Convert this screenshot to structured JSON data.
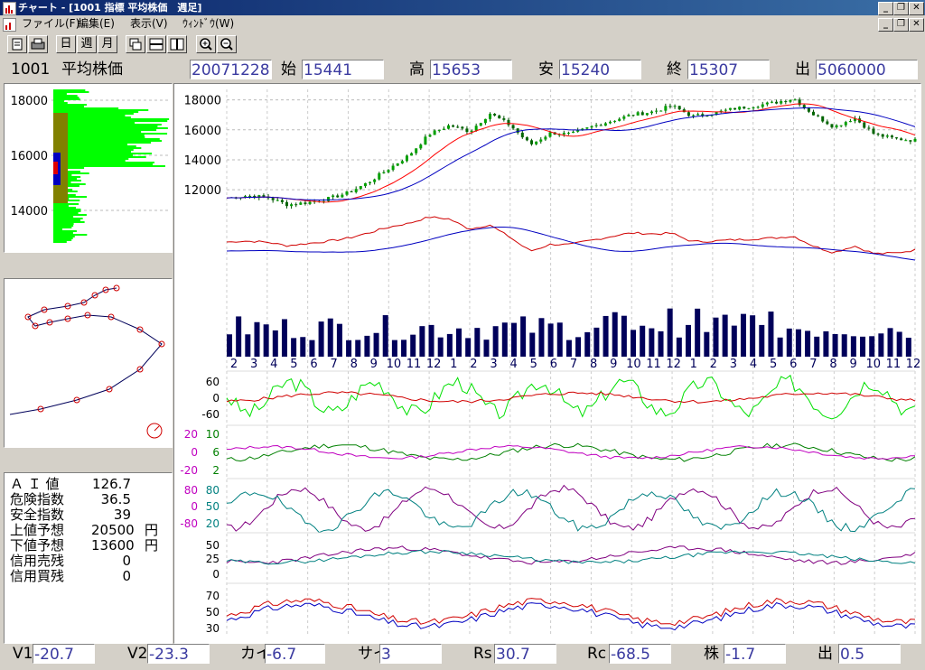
{
  "window": {
    "title": "チャート - [1001 指標 平均株価　週足]",
    "buttons": [
      "_",
      "❐",
      "✕"
    ]
  },
  "menu": {
    "items": [
      "ファイル(F)",
      "編集(E)",
      "表示(V)",
      "ｳｨﾝﾄﾞｳ(W)"
    ],
    "doc_buttons": [
      "_",
      "❐",
      "✕"
    ]
  },
  "toolbar": {
    "day": "日",
    "week": "週",
    "month": "月"
  },
  "info": {
    "code": "1001",
    "name": "平均株価",
    "date": "20071228",
    "open_label": "始",
    "open": "15441",
    "high_label": "高",
    "high": "15653",
    "low_label": "安",
    "low": "15240",
    "close_label": "終",
    "close": "15307",
    "volume_label": "出",
    "volume": "5060000"
  },
  "left_panels": {
    "profile_ticks": [
      "18000",
      "16000",
      "14000"
    ],
    "ai": {
      "rows": [
        {
          "label": "Ａ Ｉ 値",
          "value": "126.7",
          "unit": ""
        },
        {
          "label": "危険指数",
          "value": "36.5",
          "unit": ""
        },
        {
          "label": "安全指数",
          "value": "39",
          "unit": ""
        },
        {
          "label": "上値予想",
          "value": "20500",
          "unit": "円"
        },
        {
          "label": "下値予想",
          "value": "13600",
          "unit": "円"
        },
        {
          "label": "信用売残",
          "value": "0",
          "unit": ""
        },
        {
          "label": "信用買残",
          "value": "0",
          "unit": ""
        }
      ]
    }
  },
  "chart": {
    "price_ticks": [
      "18000",
      "16000",
      "14000",
      "12000"
    ],
    "months": [
      "2",
      "3",
      "4",
      "5",
      "6",
      "7",
      "8",
      "9",
      "10",
      "11",
      "12",
      "1",
      "2",
      "3",
      "4",
      "5",
      "6",
      "7",
      "8",
      "9",
      "10",
      "11",
      "12",
      "1",
      "2",
      "3",
      "4",
      "5",
      "6",
      "7",
      "8",
      "9",
      "10",
      "11",
      "12"
    ],
    "ind1_ticks": [
      "60",
      "0",
      "-60"
    ],
    "ind2_left_ticks": [
      "20",
      "0",
      "-20"
    ],
    "ind2_ticks": [
      "10",
      "6",
      "2"
    ],
    "ind3_left_ticks": [
      "80",
      "0",
      "-80"
    ],
    "ind3_ticks": [
      "80",
      "50",
      "20"
    ],
    "ind4_ticks": [
      "50",
      "25",
      "0"
    ],
    "ind5_ticks": [
      "70",
      "50",
      "30"
    ]
  },
  "chart_data": {
    "type": "line",
    "title": "1001 指標 平均株価 週足",
    "ylim": [
      10500,
      18700
    ],
    "yticks": [
      18000,
      16000,
      14000,
      12000
    ],
    "x": [
      "2",
      "3",
      "4",
      "5",
      "6",
      "7",
      "8",
      "9",
      "10",
      "11",
      "12",
      "1",
      "2",
      "3",
      "4",
      "5",
      "6",
      "7",
      "8",
      "9",
      "10",
      "11",
      "12",
      "1",
      "2",
      "3",
      "4",
      "5",
      "6",
      "7",
      "8",
      "9",
      "10",
      "11",
      "12"
    ],
    "series": [
      {
        "values": [
          11450,
          11600,
          11500,
          11000,
          11150,
          11400,
          11800,
          12500,
          13400,
          14300,
          15700,
          16300,
          15900,
          17100,
          16300,
          15000,
          15800,
          15700,
          16200,
          16600,
          17000,
          17200,
          17600,
          16900,
          17100,
          17400,
          17600,
          17800,
          18100,
          17000,
          16200,
          16800,
          15700,
          15400,
          15300
        ]
      }
    ],
    "colors": {
      "up": "#00a000",
      "down": "#006400",
      "ma_short": "#ff0000",
      "ma_long": "#0000c0",
      "volume": "#00005a",
      "profile": "#00ff00"
    }
  },
  "status": {
    "v1_label": "V1",
    "v1": "-20.7",
    "v2_label": "V2",
    "v2": "-23.3",
    "kai_label": "カイ",
    "kai": "-6.7",
    "sai_label": "サイ",
    "sai": "3",
    "rs_label": "Rs",
    "rs": "30.7",
    "rc_label": "Rc",
    "rc": "-68.5",
    "kabu_label": "株",
    "kabu": "-1.7",
    "de_label": "出",
    "de": "0.5"
  }
}
